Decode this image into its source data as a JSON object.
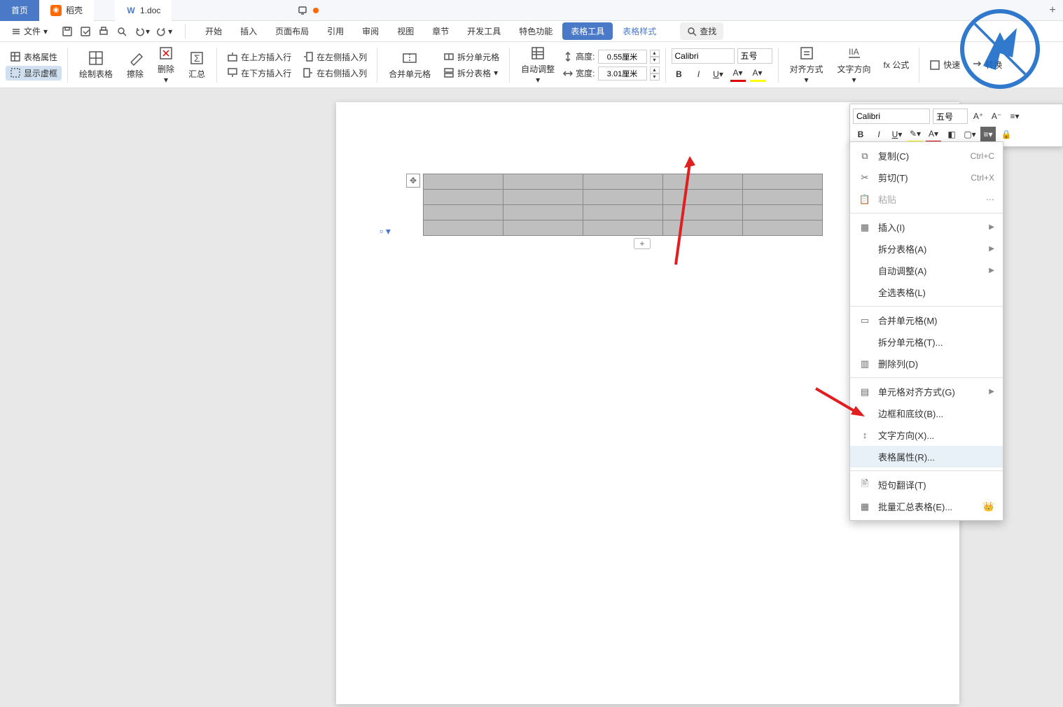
{
  "titlebar": {
    "home": "首页",
    "rice": "稻壳",
    "doc": "1.doc",
    "newtab": "+"
  },
  "menubar": {
    "file": "文件",
    "tabs": [
      "开始",
      "插入",
      "页面布局",
      "引用",
      "审阅",
      "视图",
      "章节",
      "开发工具",
      "特色功能",
      "表格工具",
      "表格样式"
    ],
    "search": "查找"
  },
  "ribbon": {
    "props": "表格属性",
    "show_ruler": "显示虚框",
    "draw": "绘制表格",
    "erase": "擦除",
    "delete": "删除",
    "sum": "汇总",
    "ins_above": "在上方插入行",
    "ins_below": "在下方插入行",
    "ins_left": "在左侧插入列",
    "ins_right": "在右侧插入列",
    "merge": "合并单元格",
    "split_cell": "拆分单元格",
    "split_table": "拆分表格",
    "autofit": "自动调整",
    "height_label": "高度:",
    "width_label": "宽度:",
    "height_val": "0.55厘米",
    "width_val": "3.01厘米",
    "font": "Calibri",
    "size": "五号",
    "align": "对齐方式",
    "text_dir": "文字方向",
    "formula": "fx 公式",
    "quick": "快速",
    "convert": "转换"
  },
  "mini": {
    "font": "Calibri",
    "size": "五号"
  },
  "context": {
    "copy": "复制(C)",
    "copy_sc": "Ctrl+C",
    "cut": "剪切(T)",
    "cut_sc": "Ctrl+X",
    "paste": "粘贴",
    "insert": "插入(I)",
    "split_table": "拆分表格(A)",
    "autofit": "自动调整(A)",
    "select_table": "全选表格(L)",
    "merge": "合并单元格(M)",
    "split_cell": "拆分单元格(T)...",
    "del_col": "删除列(D)",
    "cell_align": "单元格对齐方式(G)",
    "border": "边框和底纹(B)...",
    "text_dir": "文字方向(X)...",
    "table_props": "表格属性(R)...",
    "translate": "短句翻译(T)",
    "batch_sum": "批量汇总表格(E)..."
  }
}
